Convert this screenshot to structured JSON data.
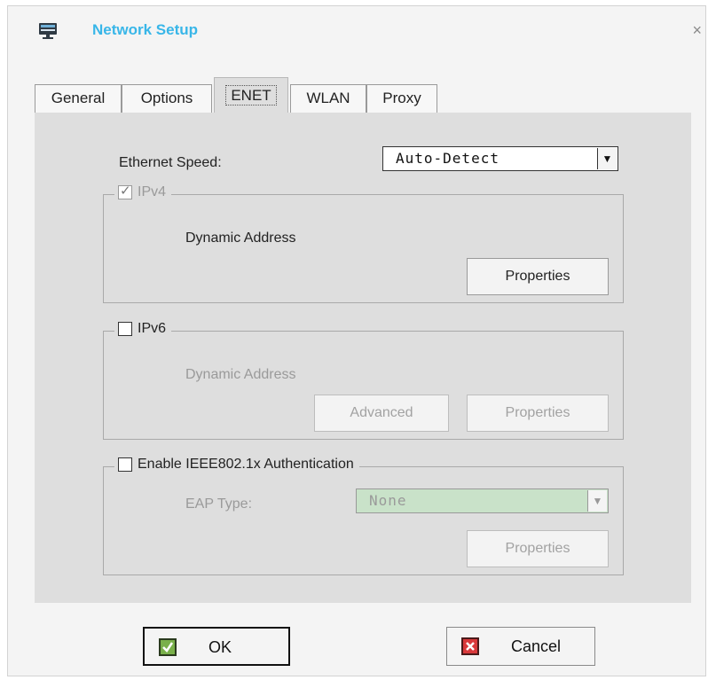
{
  "window": {
    "title": "Network Setup",
    "close_glyph": "×"
  },
  "tabs": [
    {
      "label": "General"
    },
    {
      "label": "Options"
    },
    {
      "label": "ENET"
    },
    {
      "label": "WLAN"
    },
    {
      "label": "Proxy"
    }
  ],
  "enet": {
    "ethernet_speed_label": "Ethernet Speed:",
    "ethernet_speed_value": "Auto-Detect",
    "ipv4": {
      "label": "IPv4",
      "checked": true,
      "address_mode": "Dynamic Address",
      "properties_label": "Properties"
    },
    "ipv6": {
      "label": "IPv6",
      "checked": false,
      "address_mode": "Dynamic Address",
      "advanced_label": "Advanced",
      "properties_label": "Properties"
    },
    "ieee": {
      "label": "Enable IEEE802.1x Authentication",
      "checked": false,
      "eap_type_label": "EAP Type:",
      "eap_type_value": "None",
      "properties_label": "Properties"
    }
  },
  "footer": {
    "ok_label": "OK",
    "cancel_label": "Cancel"
  },
  "colors": {
    "title": "#38b6e8",
    "panel": "#dedede",
    "eap_field": "#c9e2c9",
    "ok_icon": "#79b04a",
    "cancel_icon": "#d9393b"
  },
  "icons": {
    "app": "network-computer-icon",
    "ok": "checkmark-icon",
    "cancel": "x-mark-icon",
    "dropdown": "triangle-down-icon"
  }
}
